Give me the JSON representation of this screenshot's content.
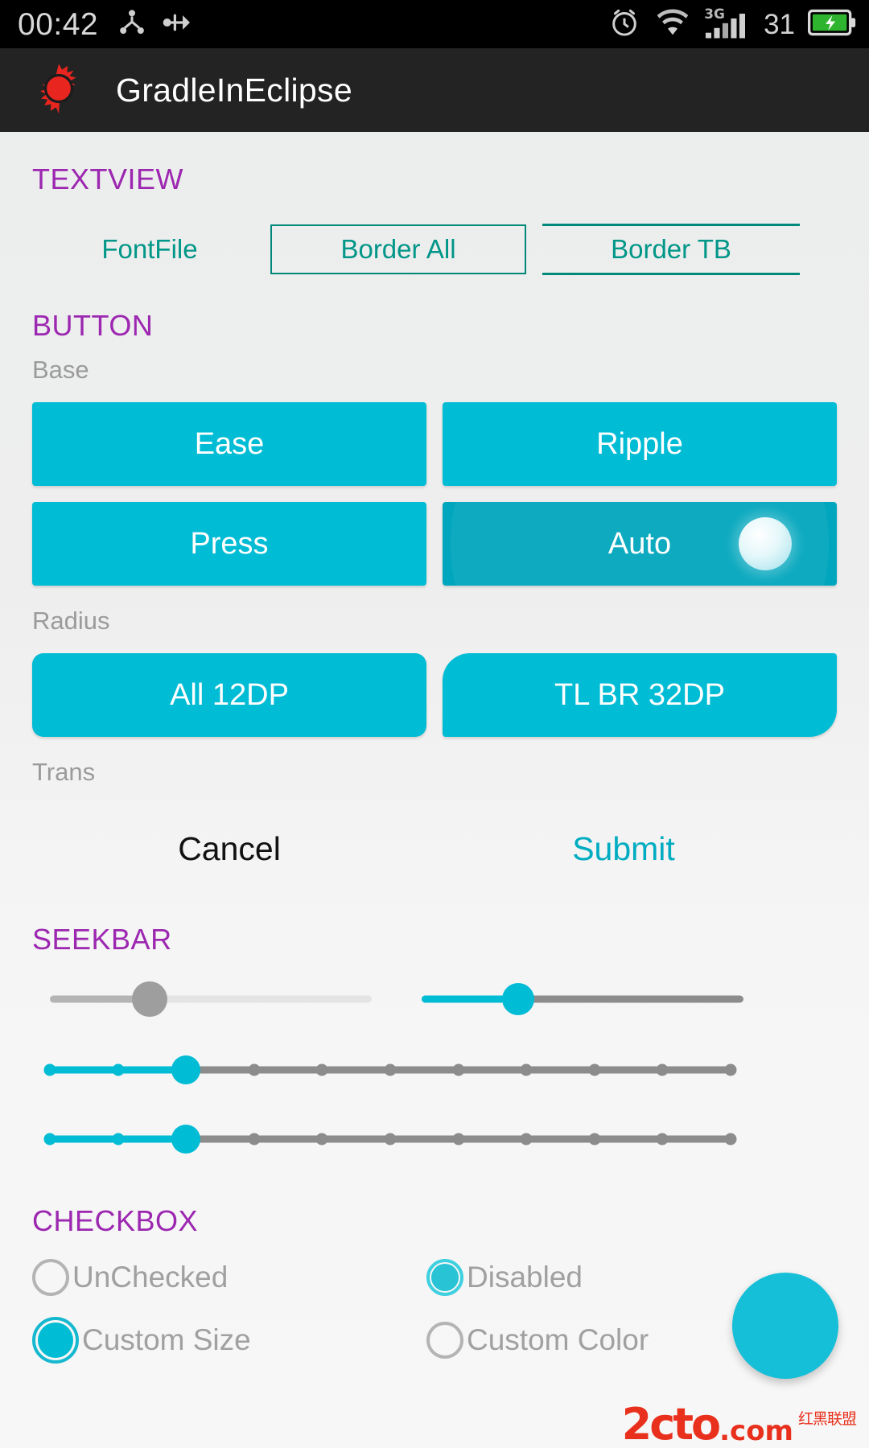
{
  "statusbar": {
    "time": "00:42",
    "battery_percent": "31",
    "left_icons": [
      "share-nodes-icon",
      "usb-transfer-icon"
    ],
    "right_icons": [
      "alarm-clock-icon",
      "wifi-icon",
      "signal-3g-icon",
      "battery-charging-icon"
    ],
    "network_label": "3G",
    "background": "#000000"
  },
  "actionbar": {
    "app_icon": "sun-burst-icon",
    "title": "GradleInEclipse",
    "background": "#232323",
    "icon_color": "#e8251f"
  },
  "theme": {
    "accent": "#00bcd4",
    "section_title_color": "#9c27b0",
    "teal": "#009688",
    "sub_label_color": "#9b9b9b",
    "page_background": "#f0f0f0"
  },
  "textview": {
    "title": "TEXTVIEW",
    "items": [
      {
        "label": "FontFile",
        "style": "plain"
      },
      {
        "label": "Border All",
        "style": "border-all"
      },
      {
        "label": "Border TB",
        "style": "border-top-bottom"
      }
    ]
  },
  "button": {
    "title": "BUTTON",
    "groups": [
      {
        "label": "Base",
        "items": [
          {
            "label": "Ease",
            "state": "normal",
            "radius": "small"
          },
          {
            "label": "Ripple",
            "state": "normal",
            "radius": "small"
          },
          {
            "label": "Press",
            "state": "normal",
            "radius": "small"
          },
          {
            "label": "Auto",
            "state": "pressed",
            "radius": "small"
          }
        ]
      },
      {
        "label": "Radius",
        "items": [
          {
            "label": "All 12DP",
            "state": "normal",
            "radius": "all-12dp"
          },
          {
            "label": "TL BR 32DP",
            "state": "normal",
            "radius": "tl-br-32dp"
          }
        ]
      },
      {
        "label": "Trans",
        "items": [
          {
            "label": "Cancel",
            "state": "normal",
            "radius": "none"
          },
          {
            "label": "Submit",
            "state": "normal",
            "radius": "none"
          }
        ]
      }
    ]
  },
  "seekbar": {
    "title": "SEEKBAR",
    "bars": [
      {
        "name": "disabled-seekbar",
        "value": 31,
        "max": 100,
        "ticks": 0,
        "progress_color": "#b4b4b4",
        "track_color": "#e4e4e4",
        "thumb_color": "#9e9e9e",
        "thumb_size": 44,
        "enabled": false
      },
      {
        "name": "accent-seekbar",
        "value": 30,
        "max": 100,
        "ticks": 0,
        "progress_color": "#00bcd4",
        "track_color": "#8c8c8c",
        "thumb_color": "#00bcd4",
        "thumb_size": 40,
        "enabled": true
      },
      {
        "name": "discrete-seekbar-1",
        "value": 2,
        "max": 10,
        "ticks": 11,
        "progress_color": "#00bcd4",
        "track_color": "#8c8c8c",
        "thumb_color": "#00bcd4",
        "thumb_size": 36,
        "enabled": true
      },
      {
        "name": "discrete-seekbar-2",
        "value": 2,
        "max": 10,
        "ticks": 11,
        "progress_color": "#00bcd4",
        "track_color": "#8c8c8c",
        "thumb_color": "#00bcd4",
        "thumb_size": 36,
        "enabled": true
      }
    ]
  },
  "checkbox": {
    "title": "CHECKBOX",
    "rows": [
      [
        {
          "label": "UnChecked",
          "checked": false,
          "size": "normal"
        },
        {
          "label": "Disabled",
          "checked": true,
          "size": "normal"
        }
      ],
      [
        {
          "label": "Custom Size",
          "checked": true,
          "size": "large"
        },
        {
          "label": "Custom Color",
          "checked": false,
          "size": "normal"
        }
      ]
    ]
  },
  "fab": {
    "name": "floating-action-button",
    "color": "#16bfd8"
  },
  "watermark": {
    "main": "2cto",
    "suffix": ".com",
    "cn": "红黑联盟",
    "color": "#e8301c"
  }
}
